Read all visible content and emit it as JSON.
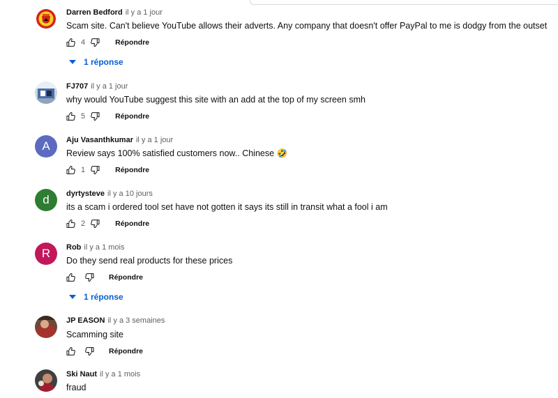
{
  "comments": [
    {
      "author": "Darren Bedford",
      "time": "il y a 1 jour",
      "text": "Scam site. Can't believe YouTube allows their adverts. Any company that doesn't offer PayPal to me is dodgy from the outset",
      "likes": "4",
      "reply_label": "Répondre",
      "replies_label": "1 réponse",
      "avatar_icon": "manchester-united-crest"
    },
    {
      "author": "FJ707",
      "time": "il y a 1 jour",
      "text": "why would YouTube suggest this site with an add at the top of my screen smh",
      "likes": "5",
      "reply_label": "Répondre",
      "avatar_icon": "photo-avatar"
    },
    {
      "author": "Aju Vasanthkumar",
      "time": "il y a 1 jour",
      "text": "Review says 100% satisfied customers now.. Chinese 🤣",
      "likes": "1",
      "reply_label": "Répondre",
      "avatar_letter": "A",
      "avatar_color": "#5c6bc0"
    },
    {
      "author": "dyrtysteve",
      "time": "il y a 10 jours",
      "text": "its a scam i ordered  tool set have not gotten it says its still in transit what a fool i am",
      "likes": "2",
      "reply_label": "Répondre",
      "avatar_letter": "d",
      "avatar_color": "#2e7d32"
    },
    {
      "author": "Rob",
      "time": "il y a 1 mois",
      "text": "Do they send real products for these prices",
      "likes": "",
      "reply_label": "Répondre",
      "replies_label": "1 réponse",
      "avatar_letter": "R",
      "avatar_color": "#c2185b"
    },
    {
      "author": "JP EASON",
      "time": "il y a 3 semaines",
      "text": "Scamming site",
      "likes": "",
      "reply_label": "Répondre",
      "avatar_icon": "photo-avatar"
    },
    {
      "author": "Ski Naut",
      "time": "il y a 1 mois",
      "text": "fraud",
      "likes": "",
      "avatar_icon": "photo-avatar"
    }
  ]
}
